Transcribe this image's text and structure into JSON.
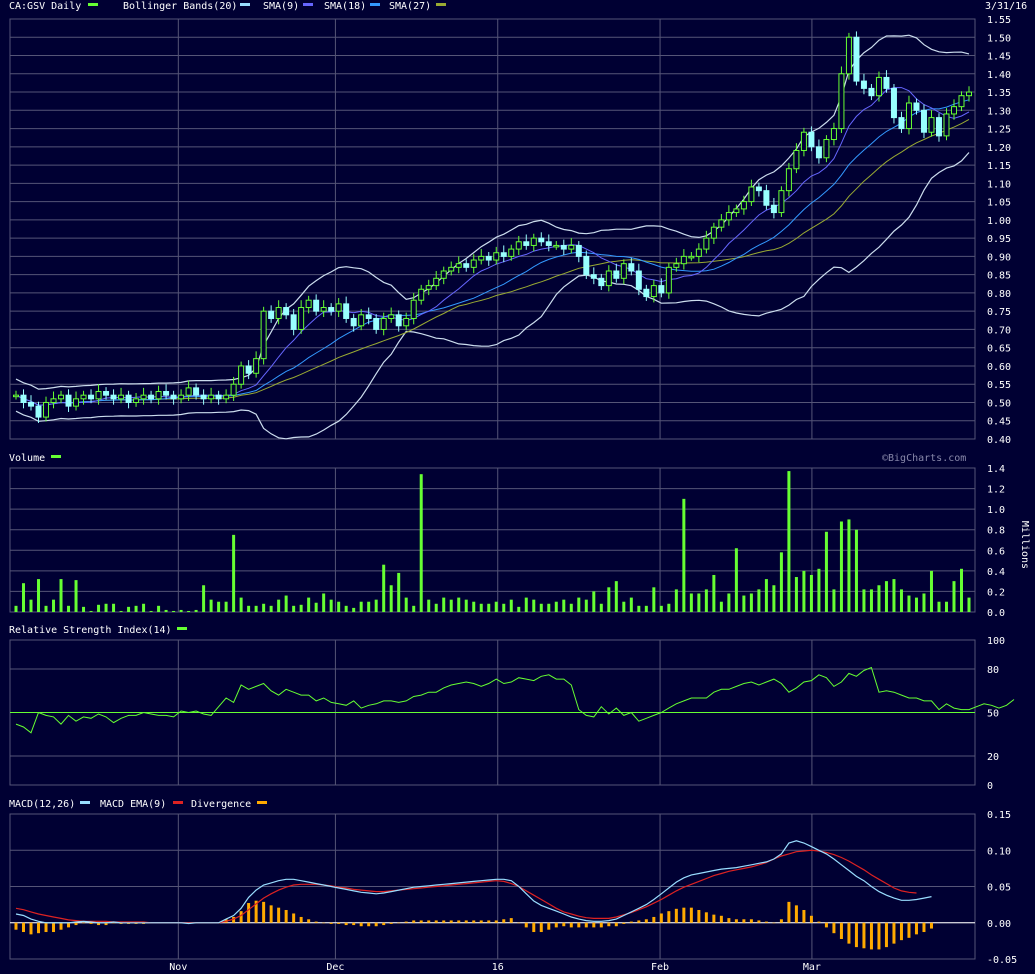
{
  "header": {
    "symbol_label": "CA:GSV Daily",
    "date_label": "3/31/16",
    "legend": [
      {
        "label": "Bollinger Bands(20)",
        "color": "#99ddff"
      },
      {
        "label": "SMA(9)",
        "color": "#6666ff"
      },
      {
        "label": "SMA(18)",
        "color": "#3399ff"
      },
      {
        "label": "SMA(27)",
        "color": "#99aa33"
      }
    ],
    "symbol_color": "#66ff33",
    "watermark": "©BigCharts.com"
  },
  "x_labels": [
    "Nov",
    "Dec",
    "16",
    "Feb",
    "Mar"
  ],
  "colors": {
    "background": "#000033",
    "grid": "#555577",
    "up_candle": "#66ff33",
    "down_candle": "#99ffff",
    "volume_bar": "#66ff33",
    "rsi_line": "#66ff33",
    "macd_line": "#99ddff",
    "macd_ema": "#dd2222",
    "divergence": "#ffaa00"
  },
  "chart_data": [
    {
      "type": "candlestick",
      "title": "CA:GSV Daily",
      "ylim": [
        0.4,
        1.55
      ],
      "y_ticks": [
        "1.55",
        "1.50",
        "1.45",
        "1.40",
        "1.35",
        "1.30",
        "1.25",
        "1.20",
        "1.15",
        "1.10",
        "1.05",
        "1.00",
        "0.95",
        "0.90",
        "0.85",
        "0.80",
        "0.75",
        "0.70",
        "0.65",
        "0.60",
        "0.55",
        "0.50",
        "0.45",
        "0.40"
      ],
      "date_start": "2015-10-01",
      "date_end": "2016-03-31",
      "close": [
        0.52,
        0.5,
        0.49,
        0.46,
        0.5,
        0.51,
        0.52,
        0.49,
        0.51,
        0.52,
        0.51,
        0.53,
        0.52,
        0.51,
        0.52,
        0.5,
        0.51,
        0.52,
        0.51,
        0.53,
        0.52,
        0.51,
        0.52,
        0.54,
        0.52,
        0.51,
        0.52,
        0.51,
        0.52,
        0.55,
        0.6,
        0.58,
        0.62,
        0.75,
        0.73,
        0.76,
        0.74,
        0.7,
        0.76,
        0.78,
        0.75,
        0.76,
        0.75,
        0.77,
        0.73,
        0.71,
        0.74,
        0.73,
        0.7,
        0.73,
        0.74,
        0.71,
        0.73,
        0.78,
        0.81,
        0.82,
        0.84,
        0.86,
        0.87,
        0.88,
        0.87,
        0.89,
        0.9,
        0.89,
        0.91,
        0.9,
        0.92,
        0.94,
        0.93,
        0.95,
        0.94,
        0.93,
        0.93,
        0.92,
        0.93,
        0.9,
        0.85,
        0.84,
        0.82,
        0.86,
        0.84,
        0.88,
        0.86,
        0.81,
        0.79,
        0.82,
        0.8,
        0.87,
        0.88,
        0.9,
        0.9,
        0.92,
        0.95,
        0.98,
        1.0,
        1.02,
        1.03,
        1.05,
        1.09,
        1.08,
        1.04,
        1.02,
        1.08,
        1.14,
        1.19,
        1.24,
        1.2,
        1.17,
        1.22,
        1.25,
        1.4,
        1.5,
        1.38,
        1.36,
        1.34,
        1.39,
        1.36,
        1.28,
        1.25,
        1.32,
        1.3,
        1.24,
        1.28,
        1.23,
        1.29,
        1.31,
        1.34,
        1.35
      ],
      "series": [
        {
          "name": "SMA(9)",
          "values": []
        },
        {
          "name": "SMA(18)",
          "values": []
        },
        {
          "name": "SMA(27)",
          "values": []
        },
        {
          "name": "Bollinger Bands(20)",
          "values": []
        }
      ]
    },
    {
      "type": "bar",
      "title": "Volume",
      "ylabel": "Millions",
      "ylim": [
        0,
        1.4
      ],
      "y_ticks": [
        "1.4",
        "1.2",
        "1.0",
        "0.8",
        "0.6",
        "0.4",
        "0.2",
        "0.0"
      ],
      "values": [
        0.06,
        0.28,
        0.12,
        0.32,
        0.06,
        0.12,
        0.32,
        0.06,
        0.31,
        0.05,
        0.01,
        0.07,
        0.08,
        0.08,
        0.01,
        0.05,
        0.06,
        0.08,
        0.01,
        0.06,
        0.02,
        0.01,
        0.02,
        0.01,
        0.02,
        0.26,
        0.12,
        0.1,
        0.1,
        0.75,
        0.14,
        0.06,
        0.06,
        0.08,
        0.06,
        0.12,
        0.16,
        0.06,
        0.07,
        0.14,
        0.09,
        0.18,
        0.12,
        0.1,
        0.06,
        0.04,
        0.1,
        0.1,
        0.12,
        0.46,
        0.26,
        0.38,
        0.14,
        0.06,
        1.34,
        0.12,
        0.08,
        0.14,
        0.12,
        0.14,
        0.12,
        0.1,
        0.08,
        0.08,
        0.1,
        0.08,
        0.12,
        0.05,
        0.14,
        0.12,
        0.08,
        0.08,
        0.1,
        0.12,
        0.08,
        0.14,
        0.12,
        0.2,
        0.08,
        0.24,
        0.3,
        0.1,
        0.14,
        0.06,
        0.06,
        0.24,
        0.06,
        0.08,
        0.22,
        1.1,
        0.18,
        0.18,
        0.22,
        0.36,
        0.1,
        0.18,
        0.62,
        0.16,
        0.18,
        0.22,
        0.32,
        0.26,
        0.58,
        1.37,
        0.34,
        0.4,
        0.36,
        0.42,
        0.78,
        0.22,
        0.88,
        0.9,
        0.8,
        0.22,
        0.22,
        0.26,
        0.3,
        0.32,
        0.22,
        0.16,
        0.14,
        0.18,
        0.4,
        0.1,
        0.1,
        0.3,
        0.42,
        0.14
      ],
      "series_name": "Volume"
    },
    {
      "type": "line",
      "title": "Relative Strength Index(14)",
      "ylim": [
        0,
        100
      ],
      "y_ticks": [
        "100",
        "80",
        "50",
        "20",
        "0"
      ],
      "reference_line": 50,
      "values": [
        42,
        40,
        36,
        50,
        48,
        47,
        42,
        48,
        44,
        47,
        46,
        49,
        47,
        43,
        46,
        48,
        48,
        50,
        49,
        48,
        48,
        47,
        51,
        50,
        51,
        49,
        48,
        54,
        60,
        57,
        69,
        66,
        68,
        70,
        65,
        62,
        66,
        64,
        62,
        62,
        58,
        60,
        57,
        56,
        55,
        58,
        53,
        55,
        56,
        58,
        58,
        57,
        58,
        61,
        62,
        64,
        64,
        67,
        69,
        70,
        71,
        70,
        68,
        70,
        73,
        70,
        71,
        74,
        73,
        72,
        75,
        76,
        73,
        73,
        69,
        52,
        48,
        47,
        54,
        49,
        53,
        48,
        50,
        44,
        46,
        48,
        50,
        53,
        56,
        58,
        60,
        60,
        60,
        64,
        66,
        66,
        68,
        70,
        71,
        69,
        71,
        73,
        70,
        64,
        67,
        71,
        72,
        76,
        74,
        68,
        71,
        77,
        75,
        79,
        81,
        64,
        65,
        64,
        62,
        60,
        60,
        58,
        58,
        52,
        56,
        53,
        52,
        52,
        54,
        56,
        55,
        53,
        55,
        59
      ],
      "series_name": "RSI"
    },
    {
      "type": "line",
      "title": "MACD(12,26)",
      "ylim": [
        -0.05,
        0.15
      ],
      "y_ticks": [
        "0.15",
        "0.10",
        "0.05",
        "0.00",
        "-0.05"
      ],
      "series": [
        {
          "name": "MACD(12,26)",
          "values": [
            0.012,
            0.01,
            0.005,
            0.002,
            0.0,
            0.0,
            0.0,
            0.0,
            0.001,
            0.002,
            0.001,
            0.0,
            0.0,
            0.001,
            0.0,
            0.0,
            0.0,
            0.0,
            0.0,
            0.0,
            0.0,
            0.0,
            0.0,
            -0.001,
            0.0,
            0.0,
            0.0,
            0.0,
            0.005,
            0.01,
            0.02,
            0.035,
            0.045,
            0.052,
            0.055,
            0.058,
            0.06,
            0.06,
            0.058,
            0.056,
            0.054,
            0.052,
            0.05,
            0.048,
            0.046,
            0.044,
            0.042,
            0.041,
            0.04,
            0.041,
            0.043,
            0.045,
            0.047,
            0.049,
            0.05,
            0.051,
            0.052,
            0.053,
            0.054,
            0.055,
            0.056,
            0.057,
            0.058,
            0.059,
            0.06,
            0.06,
            0.058,
            0.05,
            0.04,
            0.03,
            0.024,
            0.02,
            0.016,
            0.012,
            0.008,
            0.005,
            0.003,
            0.002,
            0.002,
            0.003,
            0.005,
            0.01,
            0.015,
            0.02,
            0.025,
            0.032,
            0.04,
            0.048,
            0.056,
            0.062,
            0.066,
            0.068,
            0.07,
            0.072,
            0.074,
            0.075,
            0.076,
            0.078,
            0.08,
            0.082,
            0.084,
            0.088,
            0.095,
            0.11,
            0.113,
            0.11,
            0.105,
            0.1,
            0.095,
            0.088,
            0.08,
            0.072,
            0.064,
            0.058,
            0.05,
            0.043,
            0.038,
            0.034,
            0.031,
            0.031,
            0.032,
            0.034,
            0.036
          ]
        },
        {
          "name": "MACD EMA(9)",
          "values": [
            0.02,
            0.018,
            0.015,
            0.012,
            0.01,
            0.008,
            0.006,
            0.004,
            0.003,
            0.002,
            0.002,
            0.002,
            0.002,
            0.001,
            0.001,
            0.001,
            0.001,
            0.001,
            0.0,
            0.0,
            0.0,
            0.0,
            0.0,
            0.0,
            0.0,
            0.0,
            0.0,
            0.0,
            0.002,
            0.005,
            0.01,
            0.018,
            0.026,
            0.034,
            0.04,
            0.045,
            0.049,
            0.052,
            0.053,
            0.053,
            0.053,
            0.052,
            0.051,
            0.049,
            0.048,
            0.046,
            0.045,
            0.044,
            0.043,
            0.043,
            0.044,
            0.045,
            0.046,
            0.047,
            0.048,
            0.049,
            0.05,
            0.051,
            0.052,
            0.053,
            0.054,
            0.055,
            0.056,
            0.057,
            0.058,
            0.057,
            0.054,
            0.05,
            0.044,
            0.038,
            0.032,
            0.026,
            0.02,
            0.015,
            0.012,
            0.009,
            0.007,
            0.006,
            0.006,
            0.006,
            0.008,
            0.011,
            0.014,
            0.018,
            0.022,
            0.027,
            0.032,
            0.038,
            0.044,
            0.049,
            0.053,
            0.057,
            0.061,
            0.065,
            0.068,
            0.071,
            0.073,
            0.075,
            0.077,
            0.08,
            0.083,
            0.088,
            0.092,
            0.095,
            0.098,
            0.099,
            0.1,
            0.099,
            0.097,
            0.094,
            0.09,
            0.085,
            0.079,
            0.073,
            0.066,
            0.06,
            0.054,
            0.048,
            0.044,
            0.042,
            0.041
          ]
        },
        {
          "name": "Divergence",
          "values": [
            -0.006,
            -0.008,
            -0.01,
            -0.009,
            -0.008,
            -0.008,
            -0.006,
            -0.004,
            -0.002,
            0.0,
            -0.001,
            -0.002,
            -0.002,
            0.0,
            -0.001,
            -0.001,
            -0.001,
            -0.001,
            0.0,
            0.0,
            0.0,
            0.0,
            0.0,
            -0.001,
            0.0,
            0.0,
            0.0,
            0.0,
            0.003,
            0.005,
            0.01,
            0.017,
            0.019,
            0.018,
            0.015,
            0.013,
            0.011,
            0.008,
            0.005,
            0.003,
            0.001,
            0.0,
            -0.001,
            -0.001,
            -0.002,
            -0.002,
            -0.003,
            -0.003,
            -0.003,
            -0.002,
            -0.001,
            0.0,
            0.001,
            0.002,
            0.002,
            0.002,
            0.002,
            0.002,
            0.002,
            0.002,
            0.002,
            0.002,
            0.002,
            0.002,
            0.002,
            0.003,
            0.004,
            0.0,
            -0.004,
            -0.008,
            -0.008,
            -0.006,
            -0.004,
            -0.003,
            -0.004,
            -0.004,
            -0.004,
            -0.004,
            -0.004,
            -0.003,
            -0.003,
            -0.001,
            0.001,
            0.002,
            0.003,
            0.005,
            0.008,
            0.01,
            0.012,
            0.013,
            0.013,
            0.011,
            0.009,
            0.007,
            0.006,
            0.004,
            0.003,
            0.003,
            0.003,
            0.002,
            0.001,
            0.0,
            0.003,
            0.018,
            0.015,
            0.011,
            0.006,
            0.001,
            -0.004,
            -0.009,
            -0.014,
            -0.018,
            -0.021,
            -0.022,
            -0.023,
            -0.023,
            -0.021,
            -0.018,
            -0.015,
            -0.013,
            -0.01,
            -0.008,
            -0.005
          ]
        }
      ]
    }
  ],
  "panels": {
    "volume": {
      "title": "Volume",
      "unit": "Millions"
    },
    "rsi": {
      "title": "Relative Strength Index(14)"
    },
    "macd": {
      "legend": [
        {
          "label": "MACD(12,26)",
          "color": "#99ddff"
        },
        {
          "label": "MACD EMA(9)",
          "color": "#dd2222"
        },
        {
          "label": "Divergence",
          "color": "#ffaa00"
        }
      ]
    }
  }
}
